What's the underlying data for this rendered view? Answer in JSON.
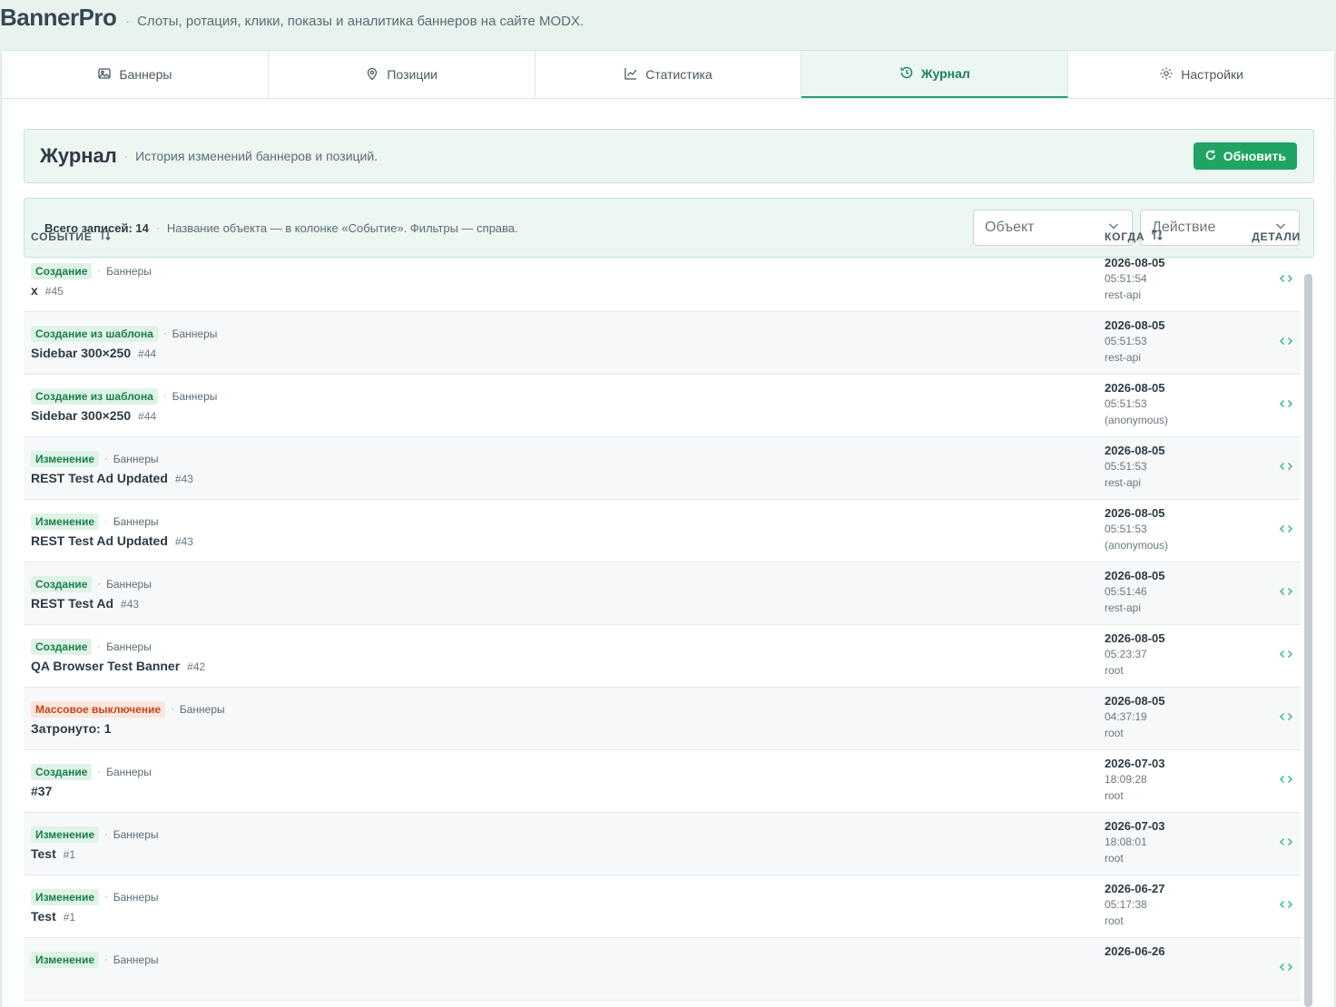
{
  "app": {
    "title": "BannerPro",
    "separator": "·",
    "description": "Слоты, ротация, клики, показы и аналитика баннеров на сайте MODX."
  },
  "tabs": [
    {
      "label": "Баннеры",
      "icon": "image-icon"
    },
    {
      "label": "Позиции",
      "icon": "map-pin-icon"
    },
    {
      "label": "Статистика",
      "icon": "chart-line-icon"
    },
    {
      "label": "Журнал",
      "icon": "history-icon",
      "active": true
    },
    {
      "label": "Настройки",
      "icon": "gear-icon"
    }
  ],
  "journal": {
    "title": "Журнал",
    "separator": "·",
    "description": "История изменений баннеров и позиций.",
    "refresh_label": "Обновить"
  },
  "filters": {
    "total_label": "Всего записей: 14",
    "separator": "·",
    "note": "Название объекта — в колонке «Событие». Фильтры — справа.",
    "object_placeholder": "Объект",
    "action_placeholder": "Действие"
  },
  "table": {
    "headers": {
      "event": "СОБЫТИЕ",
      "when": "КОГДА",
      "details": "ДЕТАЛИ"
    },
    "rows": [
      {
        "badge": "Создание",
        "type": "Баннеры",
        "name": "x",
        "id": "#45",
        "date": "2026-08-05",
        "time": "05:51:54",
        "user": "rest-api"
      },
      {
        "badge": "Создание из шаблона",
        "type": "Баннеры",
        "name": "Sidebar 300×250",
        "id": "#44",
        "date": "2026-08-05",
        "time": "05:51:53",
        "user": "rest-api"
      },
      {
        "badge": "Создание из шаблона",
        "type": "Баннеры",
        "name": "Sidebar 300×250",
        "id": "#44",
        "date": "2026-08-05",
        "time": "05:51:53",
        "user": "(anonymous)"
      },
      {
        "badge": "Изменение",
        "type": "Баннеры",
        "name": "REST Test Ad Updated",
        "id": "#43",
        "date": "2026-08-05",
        "time": "05:51:53",
        "user": "rest-api"
      },
      {
        "badge": "Изменение",
        "type": "Баннеры",
        "name": "REST Test Ad Updated",
        "id": "#43",
        "date": "2026-08-05",
        "time": "05:51:53",
        "user": "(anonymous)"
      },
      {
        "badge": "Создание",
        "type": "Баннеры",
        "name": "REST Test Ad",
        "id": "#43",
        "date": "2026-08-05",
        "time": "05:51:46",
        "user": "rest-api"
      },
      {
        "badge": "Создание",
        "type": "Баннеры",
        "name": "QA Browser Test Banner",
        "id": "#42",
        "date": "2026-08-05",
        "time": "05:23:37",
        "user": "root"
      },
      {
        "badge": "Массовое выключение",
        "badge_kind": "warn",
        "type": "Баннеры",
        "name": "Затронуто: 1",
        "id": "",
        "date": "2026-08-05",
        "time": "04:37:19",
        "user": "root"
      },
      {
        "badge": "Создание",
        "type": "Баннеры",
        "name": "#37",
        "id": "",
        "date": "2026-07-03",
        "time": "18:09:28",
        "user": "root"
      },
      {
        "badge": "Изменение",
        "type": "Баннеры",
        "name": "Test",
        "id": "#1",
        "date": "2026-07-03",
        "time": "18:08:01",
        "user": "root"
      },
      {
        "badge": "Изменение",
        "type": "Баннеры",
        "name": "Test",
        "id": "#1",
        "date": "2026-06-27",
        "time": "05:17:38",
        "user": "root"
      },
      {
        "badge": "Изменение",
        "type": "Баннеры",
        "name": "",
        "id": "",
        "date": "2026-06-26",
        "time": "",
        "user": ""
      }
    ]
  },
  "colors": {
    "accent": "#1fa463",
    "accent_bg": "#ecf7f2",
    "warn": "#c0481c"
  }
}
